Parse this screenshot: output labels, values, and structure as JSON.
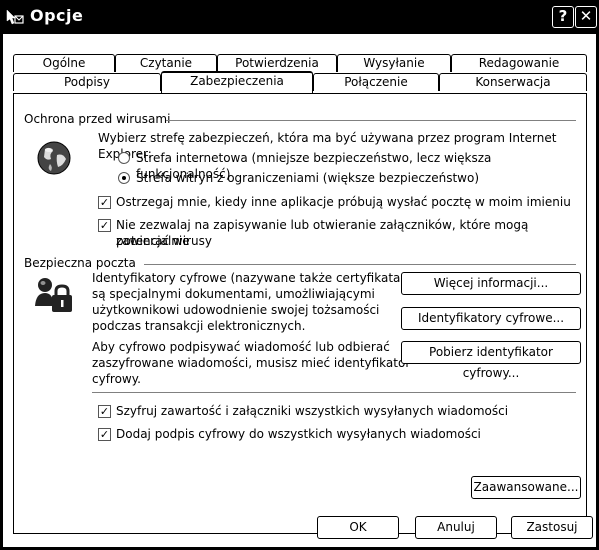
{
  "window": {
    "title": "Opcje",
    "help_label": "?",
    "close_label": "✕"
  },
  "tabs": {
    "row1": [
      "Ogólne",
      "Czytanie",
      "Potwierdzenia",
      "Wysyłanie",
      "Redagowanie"
    ],
    "row2": [
      "Podpisy",
      "Zabezpieczenia",
      "Połączenie",
      "Konserwacja"
    ],
    "active": "Zabezpieczenia"
  },
  "virus": {
    "title": "Ochrona przed wirusami",
    "zone_prompt": "Wybierz strefę zabezpieczeń, która ma być używana przez program Internet Explorer:",
    "zone_internet": "Strefa internetowa (mniejsze bezpieczeństwo, lecz większa funkcjonalność)",
    "zone_restricted": "Strefa witryn z ograniczeniami (większe bezpieczeństwo)",
    "selected_zone": "restricted",
    "warn_label": "Ostrzegaj mnie, kiedy inne aplikacje próbują wysłać pocztę w moim imieniu",
    "warn_checked": true,
    "block_label_line1": "Nie zezwalaj na zapisywanie lub otwieranie załączników, które mogą potencjalnie",
    "block_label_line2": "zawierać wirusy",
    "block_checked": true
  },
  "mail": {
    "title": "Bezpieczna poczta",
    "desc1_lines": [
      "Identyfikatory cyfrowe (nazywane także certyfikatami)",
      "są specjalnymi dokumentami, umożliwiającymi",
      "użytkownikowi udowodnienie swojej tożsamości",
      "podczas transakcji elektronicznych."
    ],
    "desc2_lines": [
      "Aby cyfrowo podpisywać wiadomość lub odbierać",
      "zaszyfrowane wiadomości, musisz mieć identyfikator",
      "cyfrowy."
    ],
    "more_info": "Więcej informacji...",
    "digital_ids": "Identyfikatory cyfrowe...",
    "get_id": "Pobierz identyfikator cyfrowy...",
    "encrypt_label": "Szyfruj zawartość i załączniki wszystkich wysyłanych wiadomości",
    "encrypt_checked": true,
    "sign_label": "Dodaj podpis cyfrowy do wszystkich wysyłanych wiadomości",
    "sign_checked": true,
    "advanced": "Zaawansowane..."
  },
  "footer": {
    "ok": "OK",
    "cancel": "Anuluj",
    "apply": "Zastosuj"
  },
  "check_mark": "✓",
  "icons": [
    "outlook-options-icon",
    "globe-icon",
    "lock-person-icon"
  ]
}
